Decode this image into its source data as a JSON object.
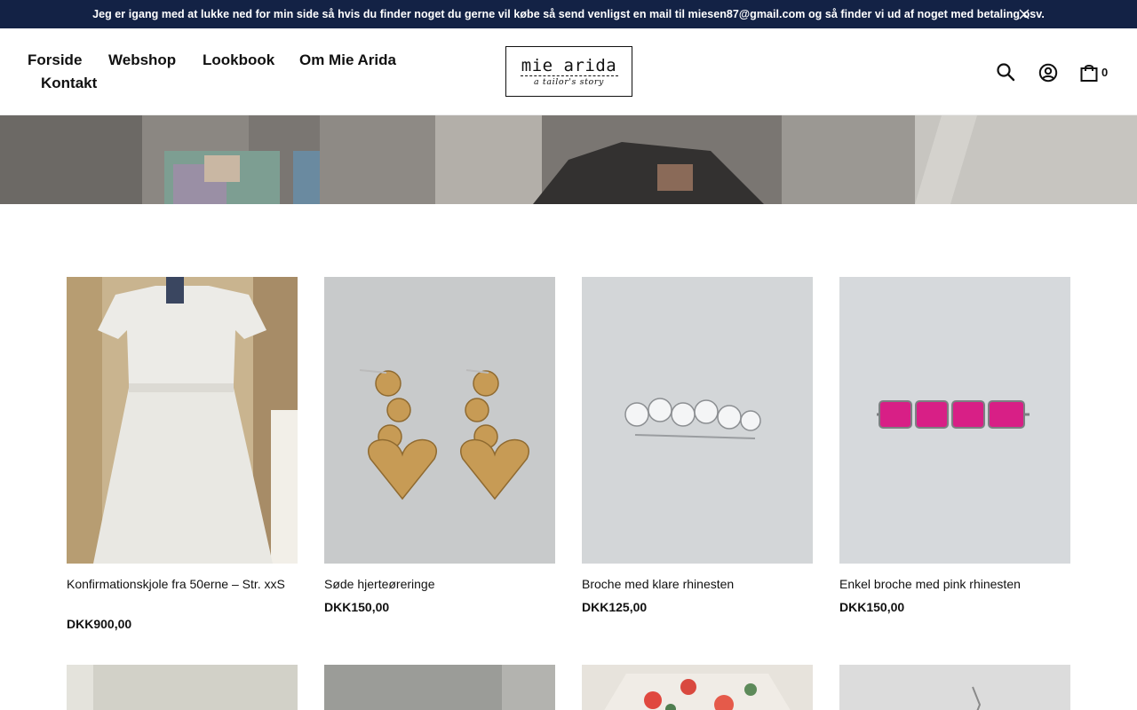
{
  "announcement": {
    "text": "Jeg er igang med at lukke ned for min side så hvis du finder noget du gerne vil købe så send venligst en mail til miesen87@gmail.com og så finder vi ud af noget med betaling osv."
  },
  "nav": {
    "items": [
      {
        "label": "Forside"
      },
      {
        "label": "Webshop"
      },
      {
        "label": "Lookbook"
      },
      {
        "label": "Om Mie Arida"
      },
      {
        "label": "Kontakt"
      }
    ]
  },
  "logo": {
    "title": "mie arida",
    "tagline": "a tailor's story"
  },
  "header_icons": {
    "search": "search-icon",
    "account": "user-icon",
    "cart": "shopping-bag-icon",
    "cart_count": "0"
  },
  "colors": {
    "announcement_bg": "#132245",
    "text": "#111111"
  },
  "products": [
    {
      "name": "Konfirmationskjole fra 50erne – Str. xxS",
      "price": "DKK900,00"
    },
    {
      "name": "Søde hjerteøreringe",
      "price": "DKK150,00"
    },
    {
      "name": "Broche med klare rhinesten",
      "price": "DKK125,00"
    },
    {
      "name": "Enkel broche med pink rhinesten",
      "price": "DKK150,00"
    }
  ]
}
